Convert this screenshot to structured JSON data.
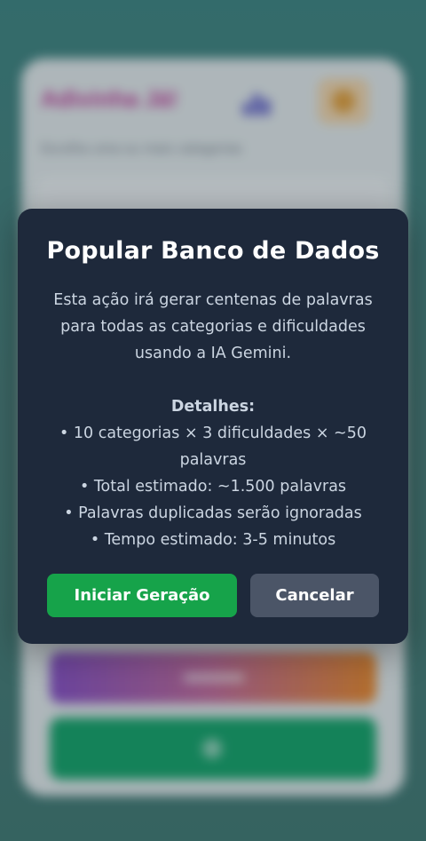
{
  "background_app": {
    "title": "Adivinha Já!",
    "subtitle": "Escolha uma ou mais categorias"
  },
  "modal": {
    "title": "Popular Banco de Dados",
    "description": "Esta ação irá gerar centenas de palavras para todas as categorias e dificuldades usando a IA Gemini.",
    "details_heading": "Detalhes:",
    "details": [
      "• 10 categorias × 3 dificuldades × ~50 palavras",
      "• Total estimado: ~1.500 palavras",
      "• Palavras duplicadas serão ignoradas",
      "• Tempo estimado: 3-5 minutos"
    ],
    "start_button": "Iniciar Geração",
    "cancel_button": "Cancelar"
  },
  "colors": {
    "modal_bg": "#1e293b",
    "start_button": "#16a34a",
    "cancel_button": "#4b5567"
  }
}
